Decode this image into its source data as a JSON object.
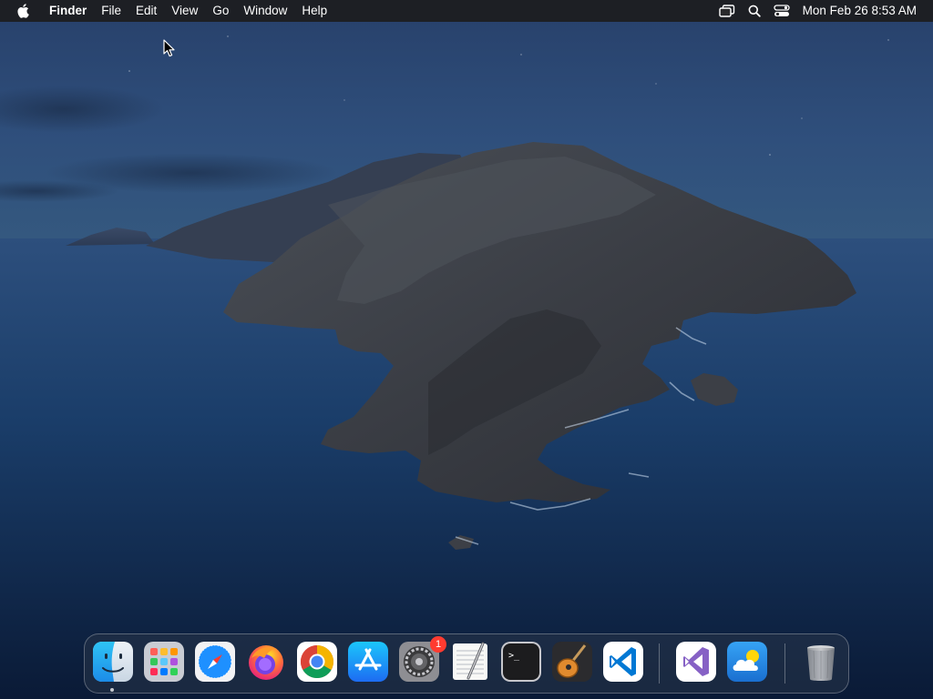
{
  "menubar": {
    "apple_icon": "apple-logo-icon",
    "app_name": "Finder",
    "menus": [
      "File",
      "Edit",
      "View",
      "Go",
      "Window",
      "Help"
    ],
    "status_icons": [
      "screen-mirroring-icon",
      "spotlight-search-icon",
      "control-center-icon"
    ],
    "clock": "Mon Feb 26  8:53 AM"
  },
  "dock": {
    "apps": [
      {
        "name": "Finder",
        "icon": "finder-icon",
        "running": true
      },
      {
        "name": "Launchpad",
        "icon": "launchpad-icon"
      },
      {
        "name": "Safari",
        "icon": "safari-icon"
      },
      {
        "name": "Firefox",
        "icon": "firefox-icon"
      },
      {
        "name": "Google Chrome",
        "icon": "chrome-icon"
      },
      {
        "name": "App Store",
        "icon": "app-store-icon"
      },
      {
        "name": "System Preferences",
        "icon": "system-preferences-icon",
        "badge": "1"
      },
      {
        "name": "TextEdit",
        "icon": "textedit-icon"
      },
      {
        "name": "Terminal",
        "icon": "terminal-icon"
      },
      {
        "name": "GarageBand",
        "icon": "garageband-icon"
      },
      {
        "name": "Visual Studio Code",
        "icon": "vscode-icon"
      },
      {
        "name": "Visual Studio",
        "icon": "visual-studio-icon"
      },
      {
        "name": "Weather",
        "icon": "weather-icon"
      },
      {
        "name": "Trash",
        "icon": "trash-icon"
      }
    ]
  },
  "colors": {
    "menubar_bg": "#1c1c1e",
    "badge_red": "#ff3b30",
    "wallpaper_sky": "#2f4f7c",
    "wallpaper_sea": "#163459"
  }
}
